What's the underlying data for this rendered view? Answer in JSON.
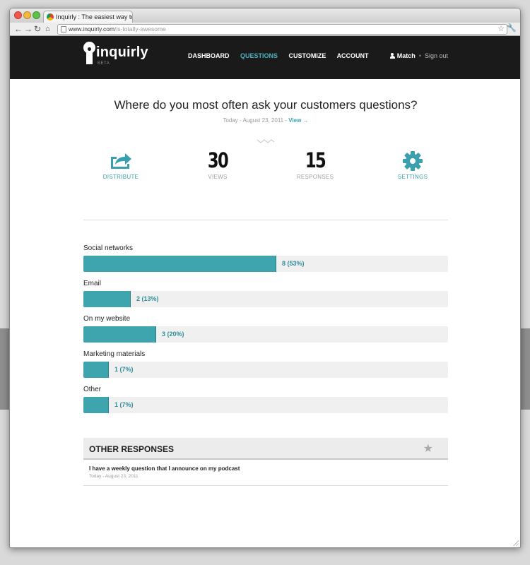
{
  "browser": {
    "tab_title": "Inquirly : The easiest way to",
    "url_host": "www.inquirly.com",
    "url_path": "/is-totally-awesome"
  },
  "header": {
    "logo_text": "inquirly",
    "logo_beta": "BETA",
    "nav": [
      {
        "label": "DASHBOARD",
        "active": false
      },
      {
        "label": "QUESTIONS",
        "active": true
      },
      {
        "label": "CUSTOMIZE",
        "active": false
      },
      {
        "label": "ACCOUNT",
        "active": false
      }
    ],
    "user": "Match",
    "separator": "•",
    "sign_out": "Sign out"
  },
  "question": {
    "title": "Where do you most often ask your customers questions?",
    "meta_prefix": "Today - August 23, 2011 -",
    "view_label": "View →"
  },
  "stats": {
    "distribute_label": "DISTRIBUTE",
    "views_value": "30",
    "views_label": "VIEWS",
    "responses_value": "15",
    "responses_label": "RESPONSES",
    "settings_label": "SETTINGS"
  },
  "results": [
    {
      "label": "Social networks",
      "count_text": "8 (53%)",
      "percent": 53
    },
    {
      "label": "Email",
      "count_text": "2 (13%)",
      "percent": 13
    },
    {
      "label": "On my website",
      "count_text": "3 (20%)",
      "percent": 20
    },
    {
      "label": "Marketing materials",
      "count_text": "1 (7%)",
      "percent": 7
    },
    {
      "label": "Other",
      "count_text": "1 (7%)",
      "percent": 7
    }
  ],
  "other_responses": {
    "title": "OTHER RESPONSES",
    "items": [
      {
        "text": "I have a weekly question that I announce on my podcast",
        "date": "Today - August 23, 2011"
      }
    ]
  },
  "colors": {
    "accent": "#3ea4ae",
    "header_bg": "#1a1a1a",
    "active_nav": "#4bb3bf"
  }
}
